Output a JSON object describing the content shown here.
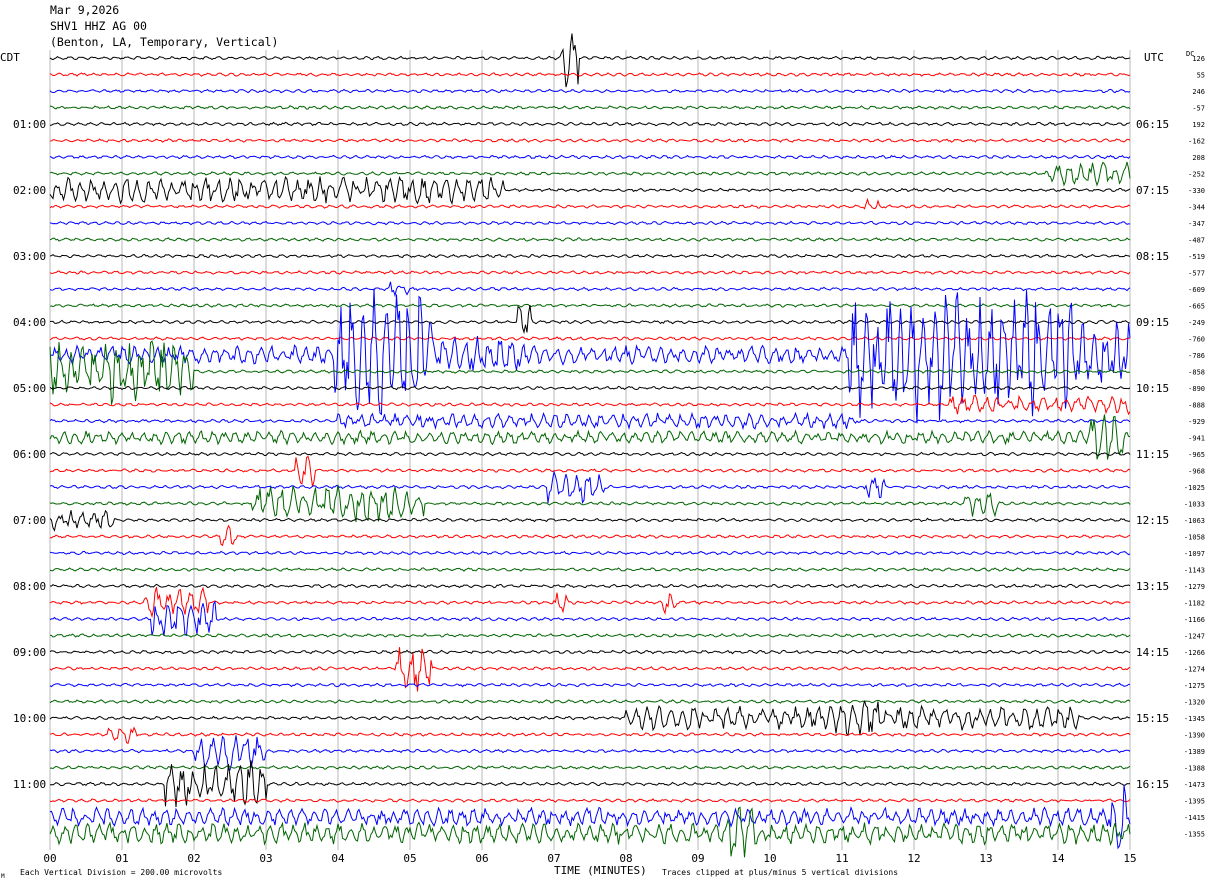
{
  "header": {
    "date": "Mar 9,2026",
    "station": "SHV1 HHZ AG 00",
    "location": "(Benton, LA, Temporary, Vertical)"
  },
  "labels": {
    "left_zone": "CDT",
    "right_zone": "UTC",
    "dc": "DC",
    "xlabel": "TIME (MINUTES)",
    "scale_note": "Each Vertical Division =  200.00 microvolts",
    "clip_note": "Traces clipped at plus/minus 5 vertical divisions"
  },
  "colors": {
    "trace_cycle": [
      "#000000",
      "#ff0000",
      "#0000ff",
      "#006400"
    ],
    "grid": "#888888"
  },
  "chart_data": {
    "type": "line",
    "title": "SHV1 HHZ AG 00",
    "xlabel": "TIME (MINUTES)",
    "xlim": [
      0,
      15
    ],
    "x_ticks": [
      "00",
      "01",
      "02",
      "03",
      "04",
      "05",
      "06",
      "07",
      "08",
      "09",
      "10",
      "11",
      "12",
      "13",
      "14",
      "15"
    ],
    "rows": 48,
    "left_time_labels": [
      {
        "row": 4,
        "label": "01:00"
      },
      {
        "row": 8,
        "label": "02:00"
      },
      {
        "row": 12,
        "label": "03:00"
      },
      {
        "row": 16,
        "label": "04:00"
      },
      {
        "row": 20,
        "label": "05:00"
      },
      {
        "row": 24,
        "label": "06:00"
      },
      {
        "row": 28,
        "label": "07:00"
      },
      {
        "row": 32,
        "label": "08:00"
      },
      {
        "row": 36,
        "label": "09:00"
      },
      {
        "row": 40,
        "label": "10:00"
      },
      {
        "row": 44,
        "label": "11:00"
      }
    ],
    "right_time_labels": [
      {
        "row": 4,
        "label": "06:15"
      },
      {
        "row": 8,
        "label": "07:15"
      },
      {
        "row": 12,
        "label": "08:15"
      },
      {
        "row": 16,
        "label": "09:15"
      },
      {
        "row": 20,
        "label": "10:15"
      },
      {
        "row": 24,
        "label": "11:15"
      },
      {
        "row": 28,
        "label": "12:15"
      },
      {
        "row": 32,
        "label": "13:15"
      },
      {
        "row": 36,
        "label": "14:15"
      },
      {
        "row": 40,
        "label": "15:15"
      },
      {
        "row": 44,
        "label": "16:15"
      }
    ],
    "dc_offsets": [
      "126",
      "55",
      "246",
      "-57",
      "192",
      "-162",
      "208",
      "-252",
      "-330",
      "-344",
      "-347",
      "-487",
      "-519",
      "-577",
      "-609",
      "-665",
      "-249",
      "-760",
      "-786",
      "-858",
      "-890",
      "-888",
      "-929",
      "-941",
      "-965",
      "-968",
      "-1025",
      "-1033",
      "-1063",
      "-1058",
      "-1097",
      "-1143",
      "-1279",
      "-1182",
      "-1166",
      "-1247",
      "-1266",
      "-1274",
      "-1275",
      "-1320",
      "-1345",
      "-1390",
      "-1389",
      "-1388",
      "-1473",
      "-1395",
      "-1415",
      "-1355"
    ],
    "amplitude_events": [
      {
        "row": 0,
        "x_start": 7.1,
        "x_end": 7.35,
        "amp": 2.2
      },
      {
        "row": 7,
        "x_start": 13.8,
        "x_end": 15.0,
        "amp": 0.9
      },
      {
        "row": 8,
        "x_start": 0.0,
        "x_end": 6.3,
        "amp": 1.0
      },
      {
        "row": 9,
        "x_start": 11.3,
        "x_end": 11.5,
        "amp": 0.6
      },
      {
        "row": 14,
        "x_start": 4.7,
        "x_end": 5.0,
        "amp": 0.6
      },
      {
        "row": 16,
        "x_start": 6.5,
        "x_end": 6.7,
        "amp": 1.5
      },
      {
        "row": 18,
        "x_start": 0.0,
        "x_end": 15.0,
        "amp": 0.7
      },
      {
        "row": 18,
        "x_start": 3.95,
        "x_end": 5.3,
        "amp": 5.0
      },
      {
        "row": 18,
        "x_start": 5.3,
        "x_end": 6.6,
        "amp": 1.4
      },
      {
        "row": 18,
        "x_start": 11.1,
        "x_end": 14.2,
        "amp": 5.0
      },
      {
        "row": 18,
        "x_start": 14.2,
        "x_end": 15.0,
        "amp": 2.5
      },
      {
        "row": 19,
        "x_start": 0.0,
        "x_end": 2.0,
        "amp": 2.5
      },
      {
        "row": 21,
        "x_start": 12.5,
        "x_end": 15.0,
        "amp": 0.7
      },
      {
        "row": 22,
        "x_start": 4.0,
        "x_end": 11.2,
        "amp": 0.6
      },
      {
        "row": 23,
        "x_start": 0.0,
        "x_end": 15.0,
        "amp": 0.5
      },
      {
        "row": 23,
        "x_start": 14.4,
        "x_end": 14.9,
        "amp": 2.0
      },
      {
        "row": 25,
        "x_start": 3.4,
        "x_end": 3.7,
        "amp": 1.3
      },
      {
        "row": 26,
        "x_start": 6.9,
        "x_end": 7.7,
        "amp": 1.2
      },
      {
        "row": 26,
        "x_start": 11.3,
        "x_end": 11.6,
        "amp": 0.9
      },
      {
        "row": 27,
        "x_start": 2.8,
        "x_end": 5.2,
        "amp": 1.4
      },
      {
        "row": 27,
        "x_start": 12.7,
        "x_end": 13.2,
        "amp": 1.0
      },
      {
        "row": 28,
        "x_start": 0.0,
        "x_end": 0.9,
        "amp": 0.8
      },
      {
        "row": 29,
        "x_start": 2.35,
        "x_end": 2.6,
        "amp": 0.9
      },
      {
        "row": 33,
        "x_start": 1.3,
        "x_end": 2.2,
        "amp": 1.2
      },
      {
        "row": 33,
        "x_start": 7.0,
        "x_end": 7.2,
        "amp": 0.8
      },
      {
        "row": 33,
        "x_start": 8.5,
        "x_end": 8.7,
        "amp": 0.8
      },
      {
        "row": 34,
        "x_start": 1.4,
        "x_end": 2.3,
        "amp": 1.5
      },
      {
        "row": 37,
        "x_start": 4.8,
        "x_end": 5.3,
        "amp": 1.8
      },
      {
        "row": 40,
        "x_start": 8.0,
        "x_end": 14.3,
        "amp": 0.9
      },
      {
        "row": 40,
        "x_start": 10.9,
        "x_end": 11.5,
        "amp": 1.5
      },
      {
        "row": 41,
        "x_start": 0.8,
        "x_end": 1.2,
        "amp": 0.8
      },
      {
        "row": 42,
        "x_start": 2.0,
        "x_end": 3.0,
        "amp": 1.6
      },
      {
        "row": 44,
        "x_start": 1.6,
        "x_end": 3.0,
        "amp": 1.8
      },
      {
        "row": 46,
        "x_start": 0.0,
        "x_end": 15.0,
        "amp": 0.7
      },
      {
        "row": 46,
        "x_start": 14.7,
        "x_end": 14.95,
        "amp": 2.5
      },
      {
        "row": 47,
        "x_start": 0.0,
        "x_end": 15.0,
        "amp": 0.8
      },
      {
        "row": 47,
        "x_start": 9.4,
        "x_end": 9.8,
        "amp": 2.5
      }
    ]
  }
}
